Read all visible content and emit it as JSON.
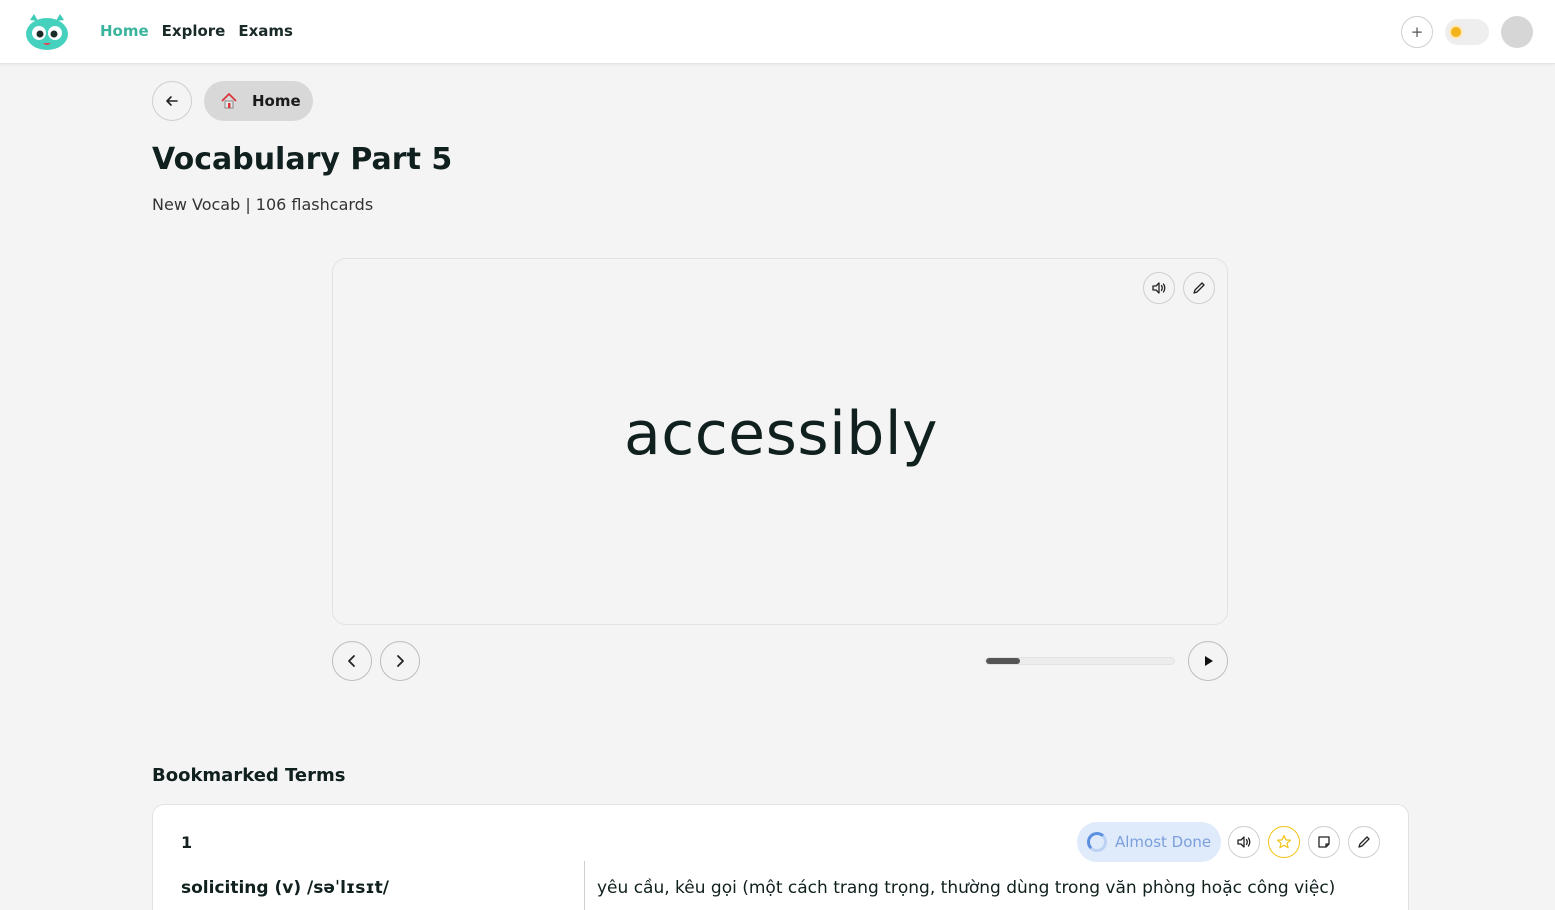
{
  "nav": {
    "items": [
      {
        "label": "Home",
        "active": true
      },
      {
        "label": "Explore",
        "active": false
      },
      {
        "label": "Exams",
        "active": false
      }
    ],
    "plus_label": "+"
  },
  "breadcrumb": {
    "home_label": "Home"
  },
  "deck": {
    "title": "Vocabulary Part 5",
    "subtitle": "New Vocab | 106 flashcards"
  },
  "flashcard": {
    "word": "accessibly",
    "progress": 0.18
  },
  "bookmarked": {
    "section_title": "Bookmarked Terms",
    "terms": [
      {
        "number": "1",
        "status": "Almost Done",
        "term": "soliciting (v) /səˈlɪsɪt/",
        "definition": "yêu cầu, kêu gọi (một cách trang trọng, thường dùng trong văn phòng hoặc công việc)"
      }
    ]
  },
  "colors": {
    "accent": "#3bb49d",
    "status_text": "#7ba0dc",
    "status_bg": "#dfeafb",
    "star": "#f0c419"
  }
}
